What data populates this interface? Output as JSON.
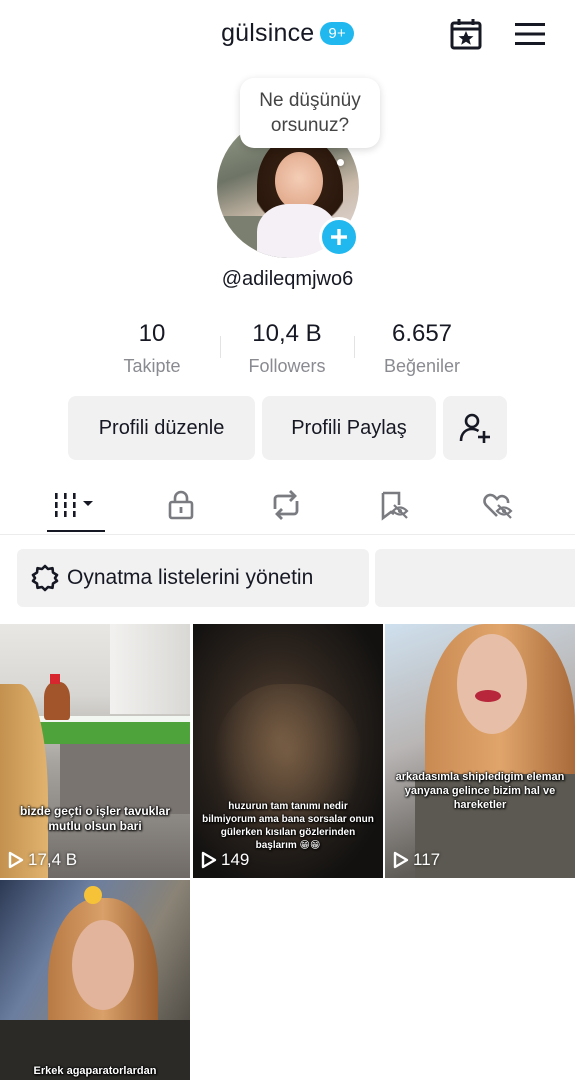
{
  "header": {
    "username": "gülsince",
    "badge": "9+",
    "calendar_icon": "calendar-star-icon",
    "menu_icon": "hamburger-menu-icon"
  },
  "profile": {
    "bubble_text": "Ne düşünüy orsunuz?",
    "handle": "@adileqmjwo6",
    "add_icon": "plus-icon"
  },
  "stats": [
    {
      "value": "10",
      "label": "Takipte"
    },
    {
      "value": "10,4 B",
      "label": "Followers"
    },
    {
      "value": "6.657",
      "label": "Beğeniler"
    }
  ],
  "actions": {
    "edit_profile": "Profili düzenle",
    "share_profile": "Profili Paylaş",
    "add_friend_icon": "add-friend-icon"
  },
  "tabs": [
    {
      "icon": "grid-icon"
    },
    {
      "icon": "lock-icon"
    },
    {
      "icon": "repost-icon"
    },
    {
      "icon": "bookmark-hidden-icon"
    },
    {
      "icon": "heart-hidden-icon"
    }
  ],
  "playlist": {
    "label": "Oynatma listelerini yönetin",
    "icon": "gear-icon"
  },
  "videos": [
    {
      "caption": "bizde geçti o işler tavuklar mutlu olsun bari",
      "views": "17,4 B"
    },
    {
      "caption": "huzurun tam tanımı nedir bilmiyorum ama bana sorsalar onun gülerken kısılan gözlerinden başlarım 😁😁",
      "views": "149"
    },
    {
      "caption": "arkadasımla shipledigim eleman yanyana gelince bizim hal ve hareketler",
      "views": "117"
    },
    {
      "caption": "Erkek agaparatorlardan",
      "views": ""
    }
  ],
  "colors": {
    "accent": "#20b8ef",
    "button_bg": "#f1f1f2",
    "text_primary": "#161823",
    "text_secondary": "#8a8b91"
  }
}
